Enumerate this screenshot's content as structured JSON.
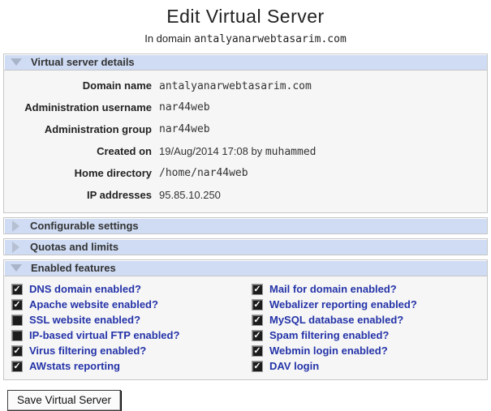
{
  "page": {
    "title": "Edit Virtual Server",
    "subtitle_prefix": "In domain",
    "subtitle_domain": "antalyanarwebtasarim.com"
  },
  "colors": {
    "header_bg": "#cfdcf4",
    "body_bg": "#f6f6f6",
    "border": "#c6c6c6",
    "feature_label_blue": "#2433a8",
    "link_blue": "#2a49b4",
    "checkbox_dark": "#1c1c1c"
  },
  "sections": [
    {
      "label": "Virtual server details",
      "expanded": true
    },
    {
      "label": "Configurable settings",
      "expanded": false
    },
    {
      "label": "Quotas and limits",
      "expanded": false
    },
    {
      "label": "Enabled features",
      "expanded": true
    }
  ],
  "details": {
    "rows": [
      {
        "label": "Domain name",
        "link": "antalyanarwebtasarim.com"
      },
      {
        "label": "Administration username",
        "mono": "nar44web"
      },
      {
        "label": "Administration group",
        "mono": "nar44web"
      },
      {
        "label": "Created on",
        "text": "19/Aug/2014 17:08 by",
        "mono": "muhammed"
      },
      {
        "label": "Home directory",
        "mono": "/home/nar44web"
      },
      {
        "label": "IP addresses",
        "text": "95.85.10.250"
      }
    ]
  },
  "features": {
    "left": [
      {
        "label": "DNS domain enabled?",
        "checked": true
      },
      {
        "label": "Apache website enabled?",
        "checked": true
      },
      {
        "label": "SSL website enabled?",
        "checked": false
      },
      {
        "label": "IP-based virtual FTP enabled?",
        "checked": false
      },
      {
        "label": "Virus filtering enabled?",
        "checked": true
      },
      {
        "label": "AWstats reporting",
        "checked": true
      }
    ],
    "right": [
      {
        "label": "Mail for domain enabled?",
        "checked": true
      },
      {
        "label": "Webalizer reporting enabled?",
        "checked": true
      },
      {
        "label": "MySQL database enabled?",
        "checked": true
      },
      {
        "label": "Spam filtering enabled?",
        "checked": true
      },
      {
        "label": "Webmin login enabled?",
        "checked": true
      },
      {
        "label": "DAV login",
        "checked": true
      }
    ]
  },
  "save_button_label": "Save Virtual Server"
}
